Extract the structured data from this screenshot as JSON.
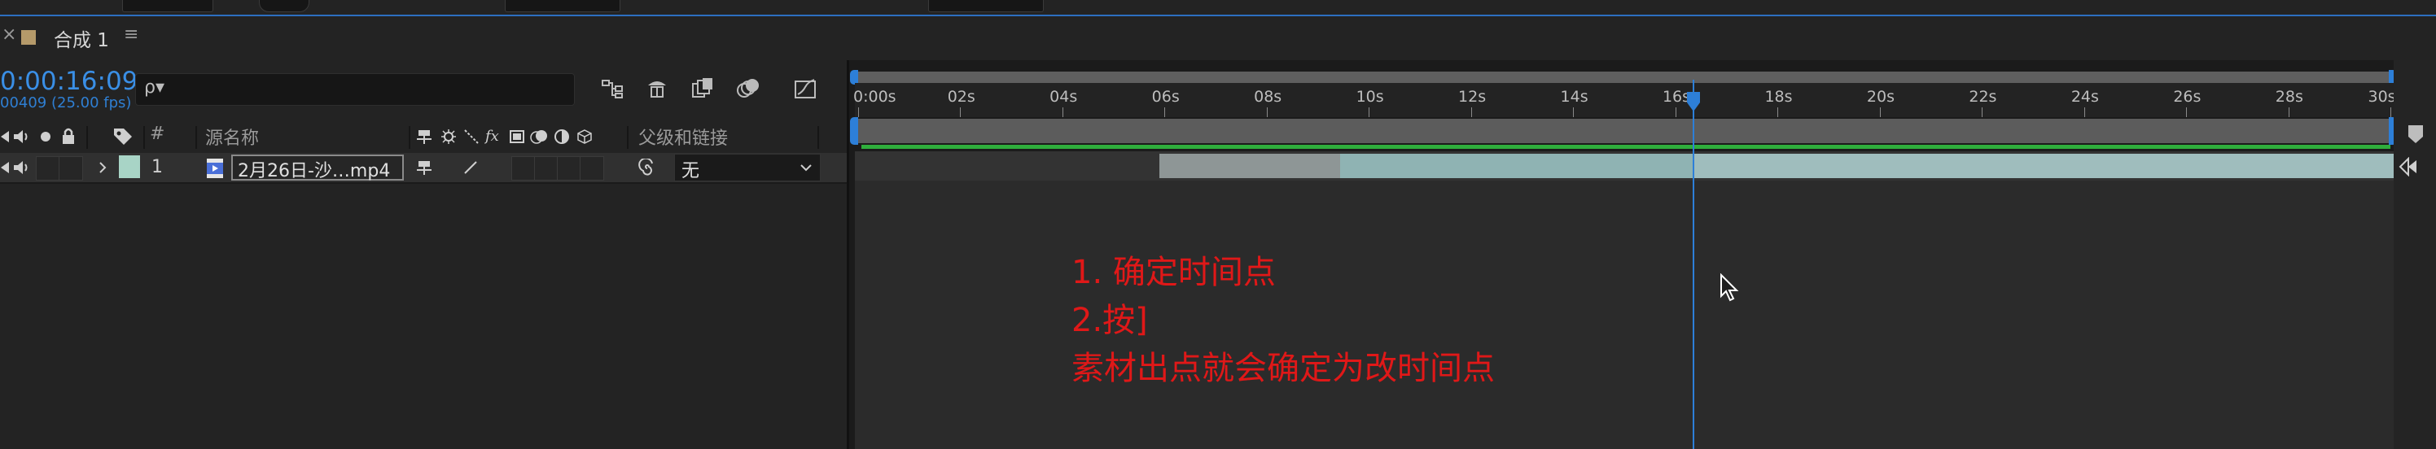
{
  "composition_tab": {
    "label": "合成 1",
    "close_glyph": "×",
    "menu_glyph": "≡"
  },
  "timecode": {
    "current": "0:00:16:09",
    "frames": "00409 (25.00 fps)"
  },
  "search": {
    "glyph": "ρ▾",
    "placeholder": ""
  },
  "columns": {
    "number": "#",
    "source_name": "源名称",
    "parent_link": "父级和链接"
  },
  "layer": {
    "number": "1",
    "name": "2月26日-沙…mp4",
    "label_color": "#a8d4c6",
    "parent_value": "无"
  },
  "ruler": {
    "ticks": [
      "0:00s",
      "02s",
      "04s",
      "06s",
      "08s",
      "10s",
      "12s",
      "14s",
      "16s",
      "18s",
      "20s",
      "22s",
      "24s",
      "26s",
      "28s",
      "30s"
    ]
  },
  "annotation": {
    "line1": "1. 确定时间点",
    "line2": "2.按]",
    "line3": "素材出点就会确定为改时间点"
  },
  "colors": {
    "accent": "#2d7fd8",
    "annotation": "#e01818",
    "cache": "#2fae3c"
  }
}
